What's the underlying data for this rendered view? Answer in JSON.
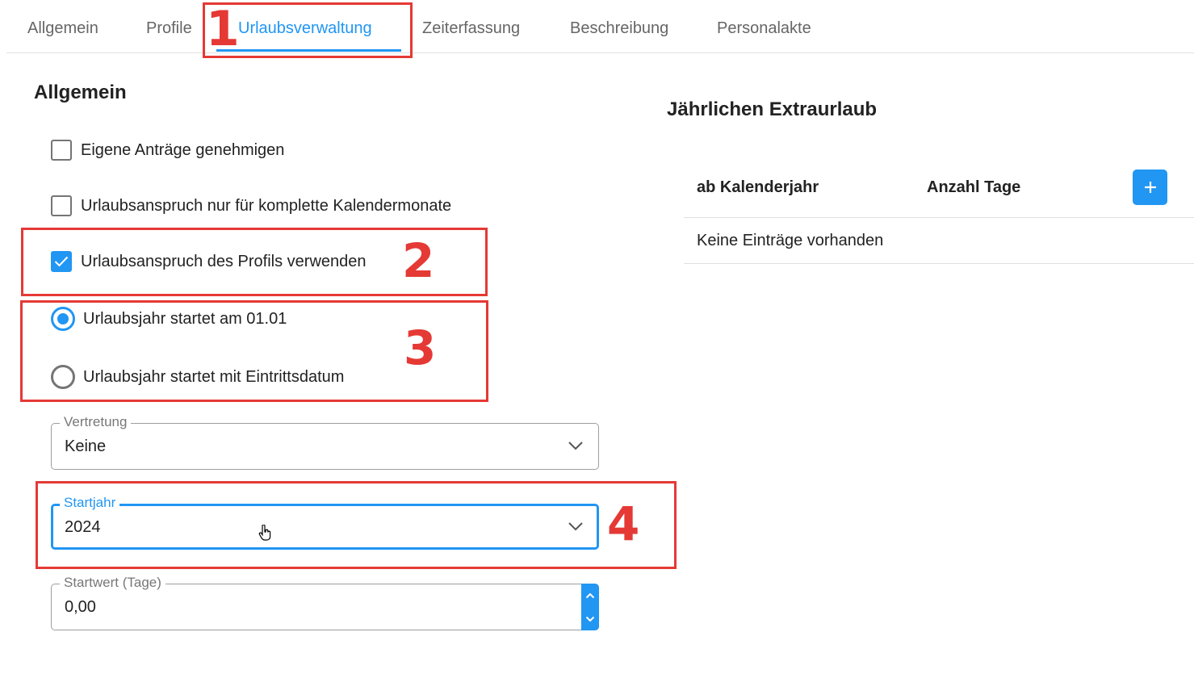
{
  "tabs": [
    {
      "label": "Allgemein",
      "active": false
    },
    {
      "label": "Profile",
      "active": false
    },
    {
      "label": "Urlaubsverwaltung",
      "active": true
    },
    {
      "label": "Zeiterfassung",
      "active": false
    },
    {
      "label": "Beschreibung",
      "active": false
    },
    {
      "label": "Personalakte",
      "active": false
    }
  ],
  "annotations": [
    "1",
    "2",
    "3",
    "4"
  ],
  "general": {
    "title": "Allgemein",
    "checkboxes": [
      {
        "label": "Eigene Anträge genehmigen",
        "checked": false
      },
      {
        "label": "Urlaubsanspruch nur für komplette Kalendermonate",
        "checked": false
      },
      {
        "label": "Urlaubsanspruch des Profils verwenden",
        "checked": true
      }
    ],
    "radios": [
      {
        "label": "Urlaubsjahr startet am 01.01",
        "checked": true
      },
      {
        "label": "Urlaubsjahr startet mit Eintrittsdatum",
        "checked": false
      }
    ],
    "fields": {
      "substitute": {
        "label": "Vertretung",
        "value": "Keine"
      },
      "start_year": {
        "label": "Startjahr",
        "value": "2024"
      },
      "start_value": {
        "label": "Startwert (Tage)",
        "value": "0,00"
      }
    }
  },
  "extra_leave": {
    "title": "Jährlichen Extraurlaub",
    "columns": [
      "ab Kalenderjahr",
      "Anzahl Tage"
    ],
    "add_label": "+",
    "empty_text": "Keine Einträge vorhanden"
  },
  "colors": {
    "accent": "#2196f3",
    "annotation": "#e53935"
  }
}
